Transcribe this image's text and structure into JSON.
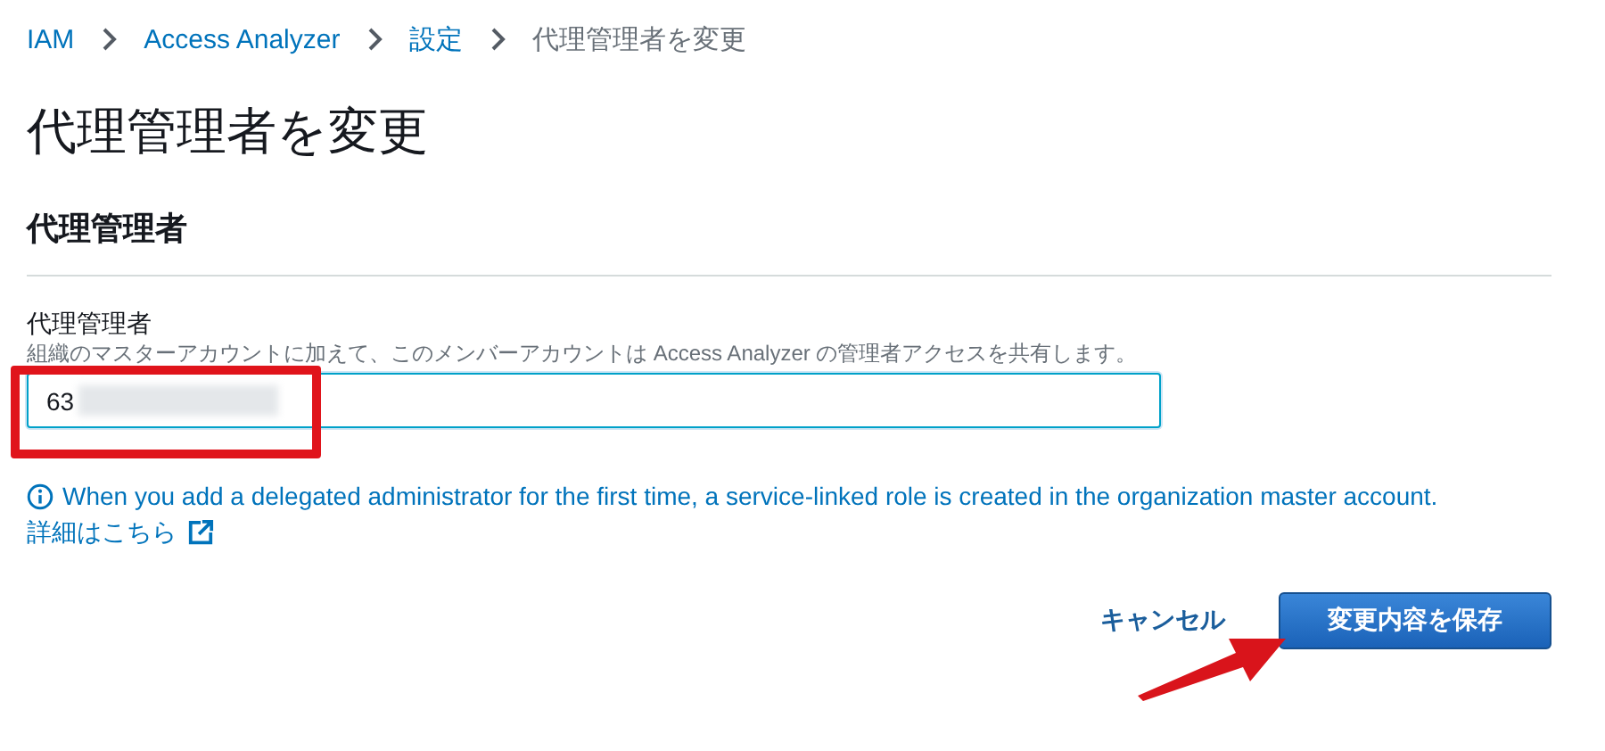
{
  "breadcrumb": [
    {
      "label": "IAM",
      "link": true
    },
    {
      "label": "Access Analyzer",
      "link": true
    },
    {
      "label": "設定",
      "link": true
    },
    {
      "label": "代理管理者を変更",
      "link": false
    }
  ],
  "title": "代理管理者を変更",
  "section": {
    "heading": "代理管理者",
    "field": {
      "label": "代理管理者",
      "description": "組織のマスターアカウントに加えて、このメンバーアカウントは Access Analyzer の管理者アクセスを共有します。",
      "value": "63"
    },
    "info": "When you add a delegated administrator for the first time, a service-linked role is created in the organization master account.",
    "link": "詳細はこちら"
  },
  "buttons": [
    {
      "label": "キャンセル",
      "kind": "link"
    },
    {
      "label": "変更内容を保存",
      "kind": "primary"
    }
  ]
}
